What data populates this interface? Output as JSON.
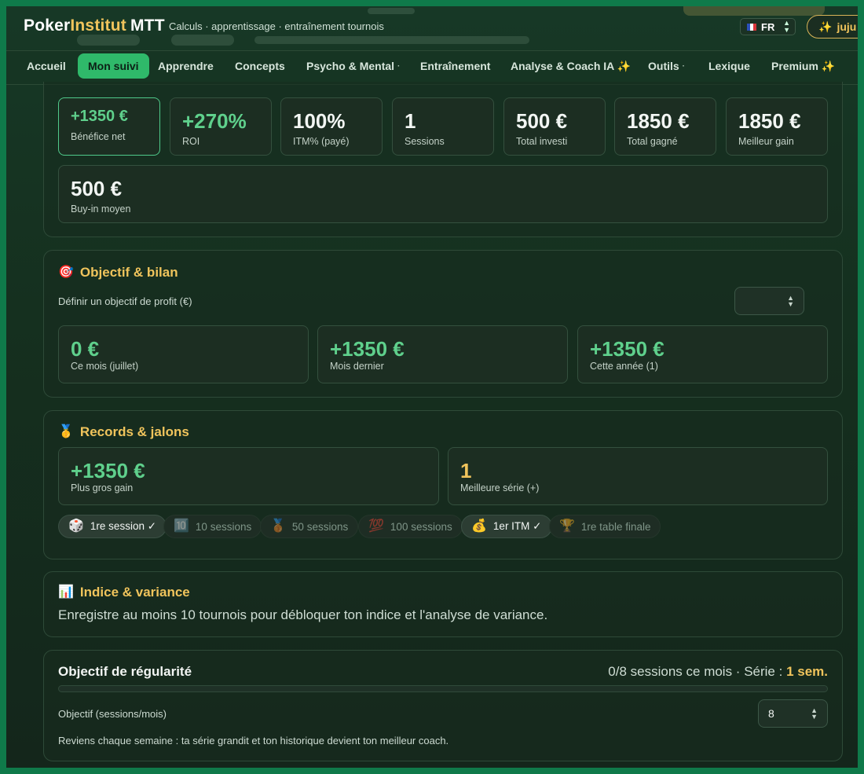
{
  "header": {
    "logo_part1": "Poker",
    "logo_part2": "Institut",
    "logo_part3": "MTT",
    "tagline": "Calculs · apprentissage · entraînement tournois",
    "language": "FR",
    "user_button": "juju",
    "user_icon": "sparkle-icon"
  },
  "nav": {
    "tabs": [
      {
        "label": "Accueil",
        "active": false
      },
      {
        "label": "Mon suivi",
        "active": true
      },
      {
        "label": "Apprendre",
        "active": false
      },
      {
        "label": "Concepts",
        "active": false
      },
      {
        "label": "Psycho & Mental",
        "dropdown": true
      },
      {
        "label": "Entraînement",
        "active": false
      },
      {
        "label": "Analyse & Coach IA ✨",
        "active": false
      },
      {
        "label": "Outils",
        "dropdown": true
      },
      {
        "label": "Lexique",
        "active": false
      },
      {
        "label": "Premium ✨",
        "active": false
      }
    ],
    "dropdown_marker": "·"
  },
  "stats": {
    "cards": [
      {
        "value": "+1350 €",
        "label": "Bénéfice net"
      },
      {
        "value": "+270%",
        "label": "ROI"
      },
      {
        "value": "100%",
        "label": "ITM% (payé)"
      },
      {
        "value": "1",
        "label": "Sessions"
      },
      {
        "value": "500 €",
        "label": "Total investi"
      },
      {
        "value": "1850 €",
        "label": "Total gagné"
      },
      {
        "value": "1850 €",
        "label": "Meilleur gain"
      }
    ],
    "avg_buyin": {
      "value": "500 €",
      "label": "Buy-in moyen"
    }
  },
  "objective": {
    "title": "Objectif & bilan",
    "icon": "target-icon",
    "field_label": "Définir un objectif de profit (€)",
    "field_value": "",
    "cards": [
      {
        "value": "0 €",
        "label": "Ce mois (juillet)"
      },
      {
        "value": "+1350 €",
        "label": "Mois dernier"
      },
      {
        "value": "+1350 €",
        "label": "Cette année (1)"
      }
    ]
  },
  "records": {
    "title": "Records & jalons",
    "icon": "medal-icon",
    "cards": [
      {
        "value": "+1350 €",
        "label": "Plus gros gain"
      },
      {
        "value": "1",
        "label": "Meilleure série (+)"
      }
    ],
    "milestones": [
      {
        "icon": "🎲",
        "label": "1re session ✓",
        "achieved": true
      },
      {
        "icon": "🔟",
        "label": "10 sessions",
        "achieved": false
      },
      {
        "icon": "🥉",
        "label": "50 sessions",
        "achieved": false
      },
      {
        "icon": "💯",
        "label": "100 sessions",
        "achieved": false
      },
      {
        "icon": "💰",
        "label": "1er ITM ✓",
        "achieved": true
      },
      {
        "icon": "🏆",
        "label": "1re table finale",
        "achieved": false
      }
    ]
  },
  "variance": {
    "title": "Indice & variance",
    "icon": "bar-chart-icon",
    "message": "Enregistre au moins 10 tournois pour débloquer ton indice et l'analyse de variance."
  },
  "regularity": {
    "title": "Objectif de régularité",
    "summary": "0/8 sessions ce mois · Série : ",
    "streak": "1 sem.",
    "progress": 0,
    "field_label": "Objectif (sessions/mois)",
    "field_value": "8",
    "tip": "Reviens chaque semaine : ta série grandit et ton historique devient ton meilleur coach."
  },
  "colors": {
    "accent_green": "#2fb96a",
    "gold": "#f0c45c",
    "value_green": "#5fd08c",
    "outer_border": "#0f7a4a"
  }
}
